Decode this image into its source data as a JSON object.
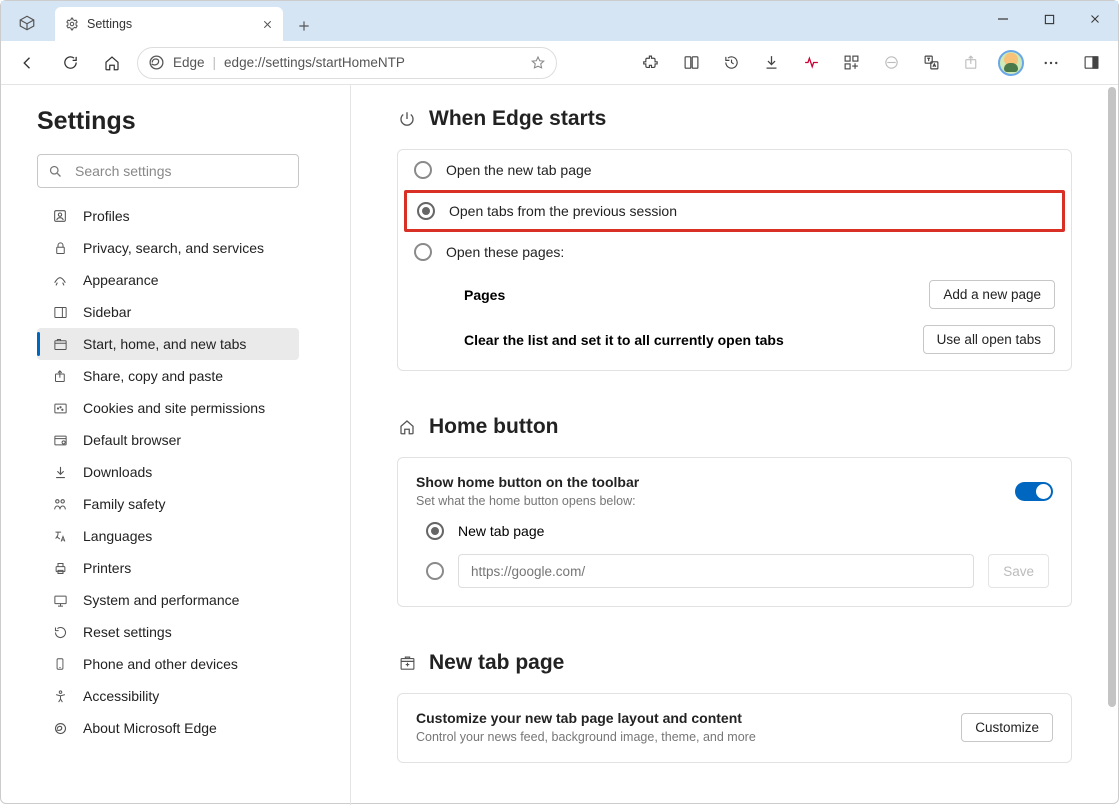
{
  "window": {
    "tab_title": "Settings"
  },
  "toolbar": {
    "edge_label": "Edge",
    "url": "edge://settings/startHomeNTP"
  },
  "sidebar": {
    "title": "Settings",
    "search_placeholder": "Search settings",
    "items": [
      {
        "label": "Profiles"
      },
      {
        "label": "Privacy, search, and services"
      },
      {
        "label": "Appearance"
      },
      {
        "label": "Sidebar"
      },
      {
        "label": "Start, home, and new tabs"
      },
      {
        "label": "Share, copy and paste"
      },
      {
        "label": "Cookies and site permissions"
      },
      {
        "label": "Default browser"
      },
      {
        "label": "Downloads"
      },
      {
        "label": "Family safety"
      },
      {
        "label": "Languages"
      },
      {
        "label": "Printers"
      },
      {
        "label": "System and performance"
      },
      {
        "label": "Reset settings"
      },
      {
        "label": "Phone and other devices"
      },
      {
        "label": "Accessibility"
      },
      {
        "label": "About Microsoft Edge"
      }
    ]
  },
  "starts": {
    "heading": "When Edge starts",
    "opt_newtab": "Open the new tab page",
    "opt_previous": "Open tabs from the previous session",
    "opt_pages": "Open these pages:",
    "pages_label": "Pages",
    "add_page_btn": "Add a new page",
    "clear_label": "Clear the list and set it to all currently open tabs",
    "use_all_btn": "Use all open tabs"
  },
  "home": {
    "heading": "Home button",
    "show_label": "Show home button on the toolbar",
    "desc": "Set what the home button opens below:",
    "opt_newtab": "New tab page",
    "url_placeholder": "https://google.com/",
    "save_btn": "Save"
  },
  "newtab": {
    "heading": "New tab page",
    "customize_title": "Customize your new tab page layout and content",
    "customize_desc": "Control your news feed, background image, theme, and more",
    "customize_btn": "Customize"
  }
}
